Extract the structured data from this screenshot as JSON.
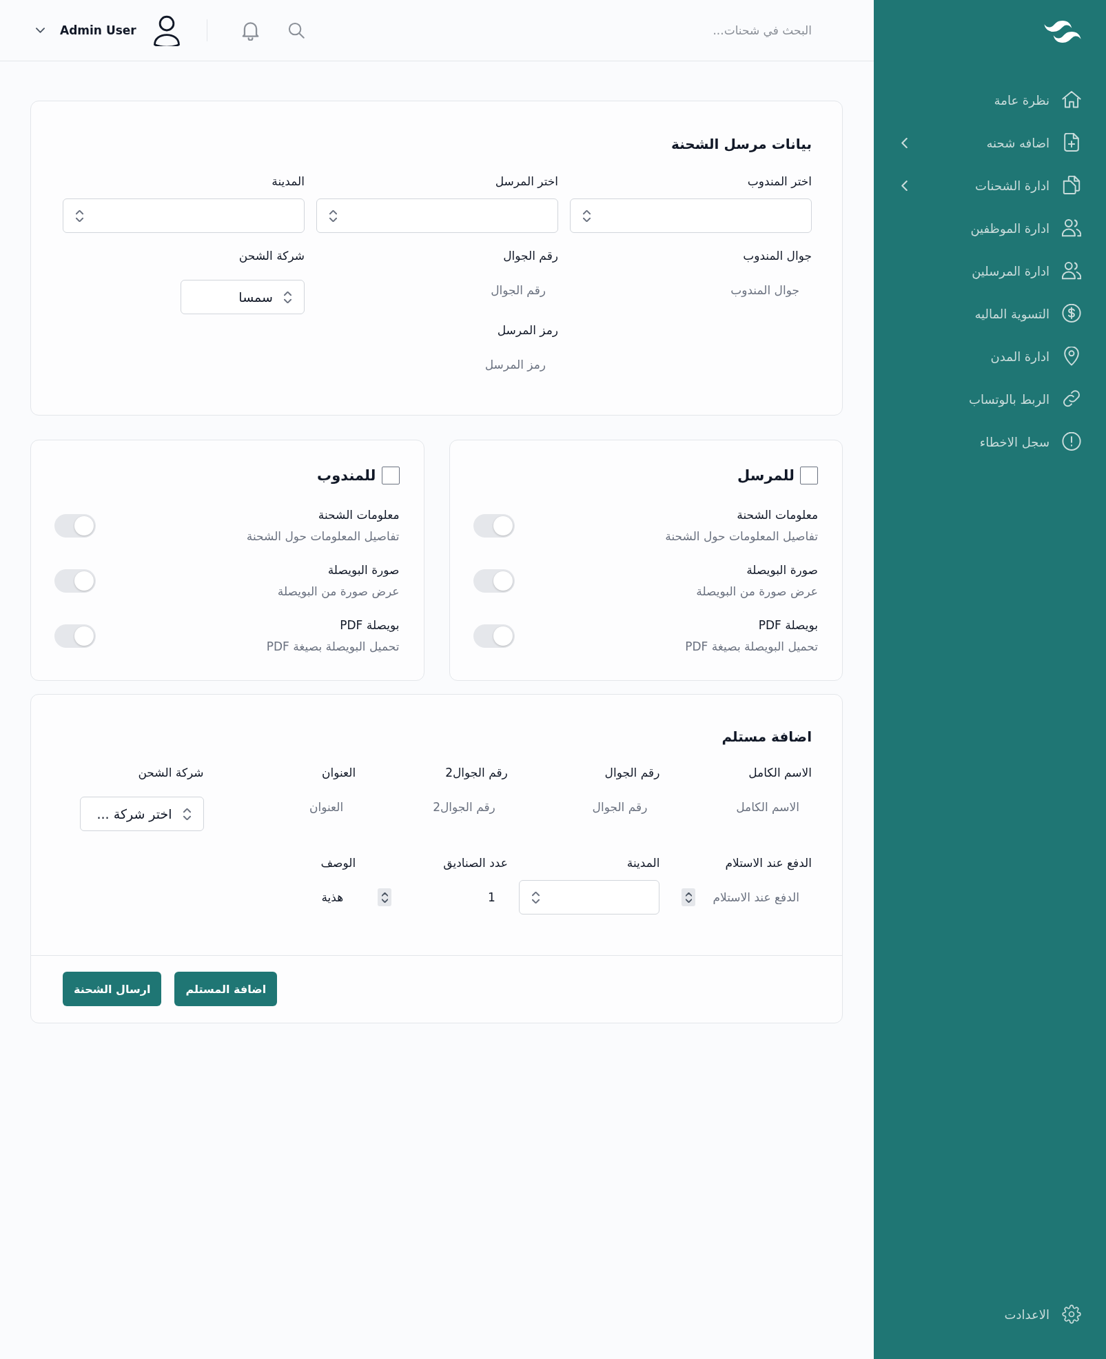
{
  "sidebar": {
    "items": [
      {
        "label": "نظرة عامة",
        "has_submenu": false,
        "selected": false
      },
      {
        "label": "اضافه شحنه",
        "has_submenu": true,
        "selected": false
      },
      {
        "label": "ادارة الشحنات",
        "has_submenu": true,
        "selected": false
      },
      {
        "label": "ادارة الموظفين",
        "has_submenu": false,
        "selected": false
      },
      {
        "label": "ادارة المرسلين",
        "has_submenu": false,
        "selected": false
      },
      {
        "label": "التسوية الماليه",
        "has_submenu": false,
        "selected": false
      },
      {
        "label": "ادارة المدن",
        "has_submenu": false,
        "selected": false
      },
      {
        "label": "الربط بالوتساب",
        "has_submenu": false,
        "selected": false
      },
      {
        "label": "سجل الاخطاء",
        "has_submenu": false,
        "selected": false
      }
    ],
    "footer_item": {
      "label": "الاعدادت"
    }
  },
  "header": {
    "search": {
      "placeholder": "البحث في شحنات..."
    },
    "user": {
      "name": "Admin User"
    }
  },
  "sender_section": {
    "title": "بيانات مرسل الشحنة",
    "columns": [
      [
        {
          "label": "اختر المندوب",
          "kind": "select"
        },
        {
          "label": "جوال المندوب",
          "kind": "text",
          "placeholder": "جوال المندوب"
        }
      ],
      [
        {
          "label": "اختر المرسل",
          "kind": "select"
        },
        {
          "label": "رقم الجوال",
          "kind": "text",
          "placeholder": "رقم الجوال"
        },
        {
          "label": "رمز المرسل",
          "kind": "text",
          "placeholder": "رمز المرسل"
        }
      ],
      [
        {
          "label": "المدينة",
          "kind": "select"
        },
        {
          "label": "شركة الشحن",
          "kind": "select_small",
          "value": "سمسا"
        }
      ]
    ]
  },
  "notification_panels": [
    {
      "title": "للمرسل",
      "checked": false,
      "options": [
        {
          "title": "معلومات الشحنة",
          "description": "تفاصيل المعلومات حول الشحنة",
          "on": false
        },
        {
          "title": "صورة البويصلة",
          "description": "عرض صورة من البويصلة",
          "on": false
        },
        {
          "title": "بويصلة PDF",
          "description": "تحميل البويصلة بصيغة PDF",
          "on": false
        }
      ]
    },
    {
      "title": "للمندوب",
      "checked": false,
      "options": [
        {
          "title": "معلومات الشحنة",
          "description": "تفاصيل المعلومات حول الشحنة",
          "on": false
        },
        {
          "title": "صورة البويصلة",
          "description": "عرض صورة من البويصلة",
          "on": false
        },
        {
          "title": "بويصلة PDF",
          "description": "تحميل البويصلة بصيغة PDF",
          "on": false
        }
      ]
    }
  ],
  "recipient_section": {
    "title": "اضافة مستلم",
    "fields": [
      {
        "label": "الاسم الكامل",
        "kind": "text",
        "placeholder": "الاسم الكامل"
      },
      {
        "label": "رقم الجوال",
        "kind": "text",
        "placeholder": "رقم الجوال"
      },
      {
        "label": "رقم الجوال2",
        "kind": "text",
        "placeholder": "رقم الجوال2"
      },
      {
        "label": "العنوان",
        "kind": "text",
        "placeholder": "العنوان"
      },
      {
        "label": "شركة الشحن",
        "kind": "select_small",
        "value": "اختر شركة ..."
      },
      {
        "label": "الدفع عند الاستلام",
        "kind": "number",
        "placeholder": "الدفع عند الاستلام"
      },
      {
        "label": "المدينة",
        "kind": "select"
      },
      {
        "label": "عدد الصناديق",
        "kind": "number",
        "value": "1"
      },
      {
        "label": "الوصف",
        "kind": "text",
        "value": "هذية"
      }
    ],
    "buttons": [
      "اضافة المستلم",
      "ارسال الشحنة"
    ]
  }
}
